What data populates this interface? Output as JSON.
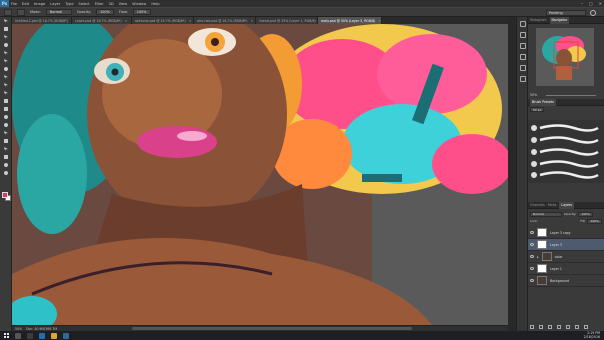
{
  "menubar": {
    "logo": "Ps",
    "items": [
      "File",
      "Edit",
      "Image",
      "Layer",
      "Type",
      "Select",
      "Filter",
      "3D",
      "View",
      "Window",
      "Help"
    ]
  },
  "options": {
    "mode_label": "Mode:",
    "mode_value": "Normal",
    "opacity_label": "Opacity:",
    "opacity_value": "100%",
    "flow_label": "Flow:",
    "flow_value": "100%",
    "workspace": "Painting"
  },
  "tabs": [
    {
      "label": "Untitled-2.psd @ 16.7% (RGB/8*)",
      "active": false
    },
    {
      "label": "colors.psd @ 16.7% (RGB/8*)",
      "active": false
    },
    {
      "label": "skintone.psd @ 16.7% (RGB/8*)",
      "active": false
    },
    {
      "label": "afro-hair.psd @ 16.7% (RGB/8*)",
      "active": false
    },
    {
      "label": "lineart.psd @ 33% (Layer 1, RGB/8)",
      "active": false
    },
    {
      "label": "malu.psd @ 50% (Layer 3, RGB/8)",
      "active": true
    }
  ],
  "status": {
    "zoom": "50%",
    "doc": "Doc: 40.9M/366.7M"
  },
  "panels": {
    "nav_tabs": [
      "Histogram",
      "Navigator"
    ],
    "nav_zoom": "50%",
    "brush_tabs": [
      "Brush Presets"
    ],
    "brush_size": "50 px",
    "layers_tabs": [
      "Channels",
      "Paths",
      "Layers"
    ],
    "blend_mode": "Normal",
    "opacity_label": "Opacity:",
    "opacity_value": "100%",
    "lock_label": "Lock:",
    "fill_label": "Fill:",
    "fill_value": "100%",
    "layers": [
      {
        "name": "Layer 3 copy",
        "selected": false,
        "thumb": "light"
      },
      {
        "name": "Layer 3",
        "selected": true,
        "thumb": "light"
      },
      {
        "name": "color",
        "selected": false,
        "thumb": "dark",
        "group": true
      },
      {
        "name": "Layer 1",
        "selected": false,
        "thumb": "light"
      },
      {
        "name": "Background",
        "selected": false,
        "thumb": "dark"
      }
    ]
  },
  "taskbar": {
    "time": "2:19 PM",
    "date": "2/18/2016"
  },
  "colors": {
    "foreground": "#d63a6b",
    "background": "#ffffff",
    "accent": "#4e5a6e"
  }
}
